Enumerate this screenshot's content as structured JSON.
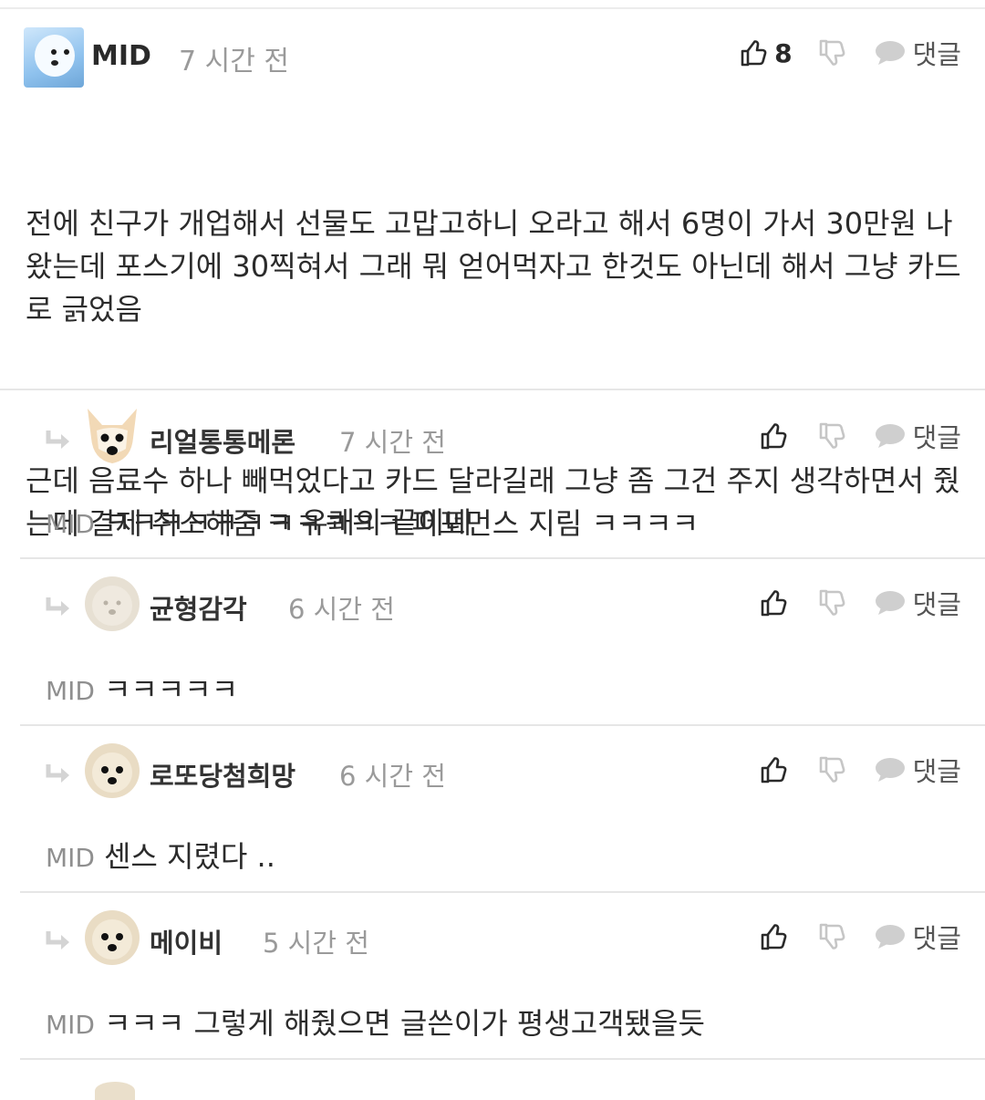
{
  "main_comment": {
    "author": "MID",
    "time": "7 시간 전",
    "likes": "8",
    "reply_label": "댓글",
    "paragraphs": [
      "전에 친구가 개업해서 선물도 고맙고하니 오라고 해서 6명이 가서 30만원 나왔는데 포스기에 30찍혀서 그래 뭐 얻어먹자고 한것도 아닌데 해서 그냥 카드로 긁었음",
      "근데 음료수 하나 빼먹었다고 카드 달라길래 그냥 좀 그건 주지 생각하면서 줬는데 결제 취소해줌 ㅋㅋㅋㅋㅋ 퍼포먼스 지림 ㅋㅋㅋㅋ"
    ]
  },
  "replies": [
    {
      "author": "리얼통통메론",
      "time": "7 시간 전",
      "mention": "MID",
      "text": "ㅋㅋㅋㅋㅋㅋㅋ 유쾌의 끝이네",
      "reply_label": "댓글",
      "avatar": "fox-dog-avatar"
    },
    {
      "author": "균형감각",
      "time": "6 시간 전",
      "mention": "MID",
      "text": "ㅋㅋㅋㅋㅋ",
      "reply_label": "댓글",
      "avatar": "puppy-avatar-faded"
    },
    {
      "author": "로또당첨희망",
      "time": "6 시간 전",
      "mention": "MID",
      "text": "센스 지렸다 ..",
      "reply_label": "댓글",
      "avatar": "puppy-avatar"
    },
    {
      "author": "메이비",
      "time": "5 시간 전",
      "mention": "MID",
      "text": "ㅋㅋㅋ 그렇게 해줬으면 글쓴이가 평생고객됐을듯",
      "reply_label": "댓글",
      "avatar": "puppy-avatar"
    }
  ],
  "icons": {
    "like": "thumbs-up-icon",
    "dislike": "thumbs-down-icon",
    "reply": "speech-bubble-icon",
    "reply_indent": "reply-arrow-icon"
  },
  "colors": {
    "text": "#2b2b2b",
    "muted": "#9a9a9a",
    "separator": "#e6e6e6",
    "icon_gray": "#c8c8c8"
  }
}
